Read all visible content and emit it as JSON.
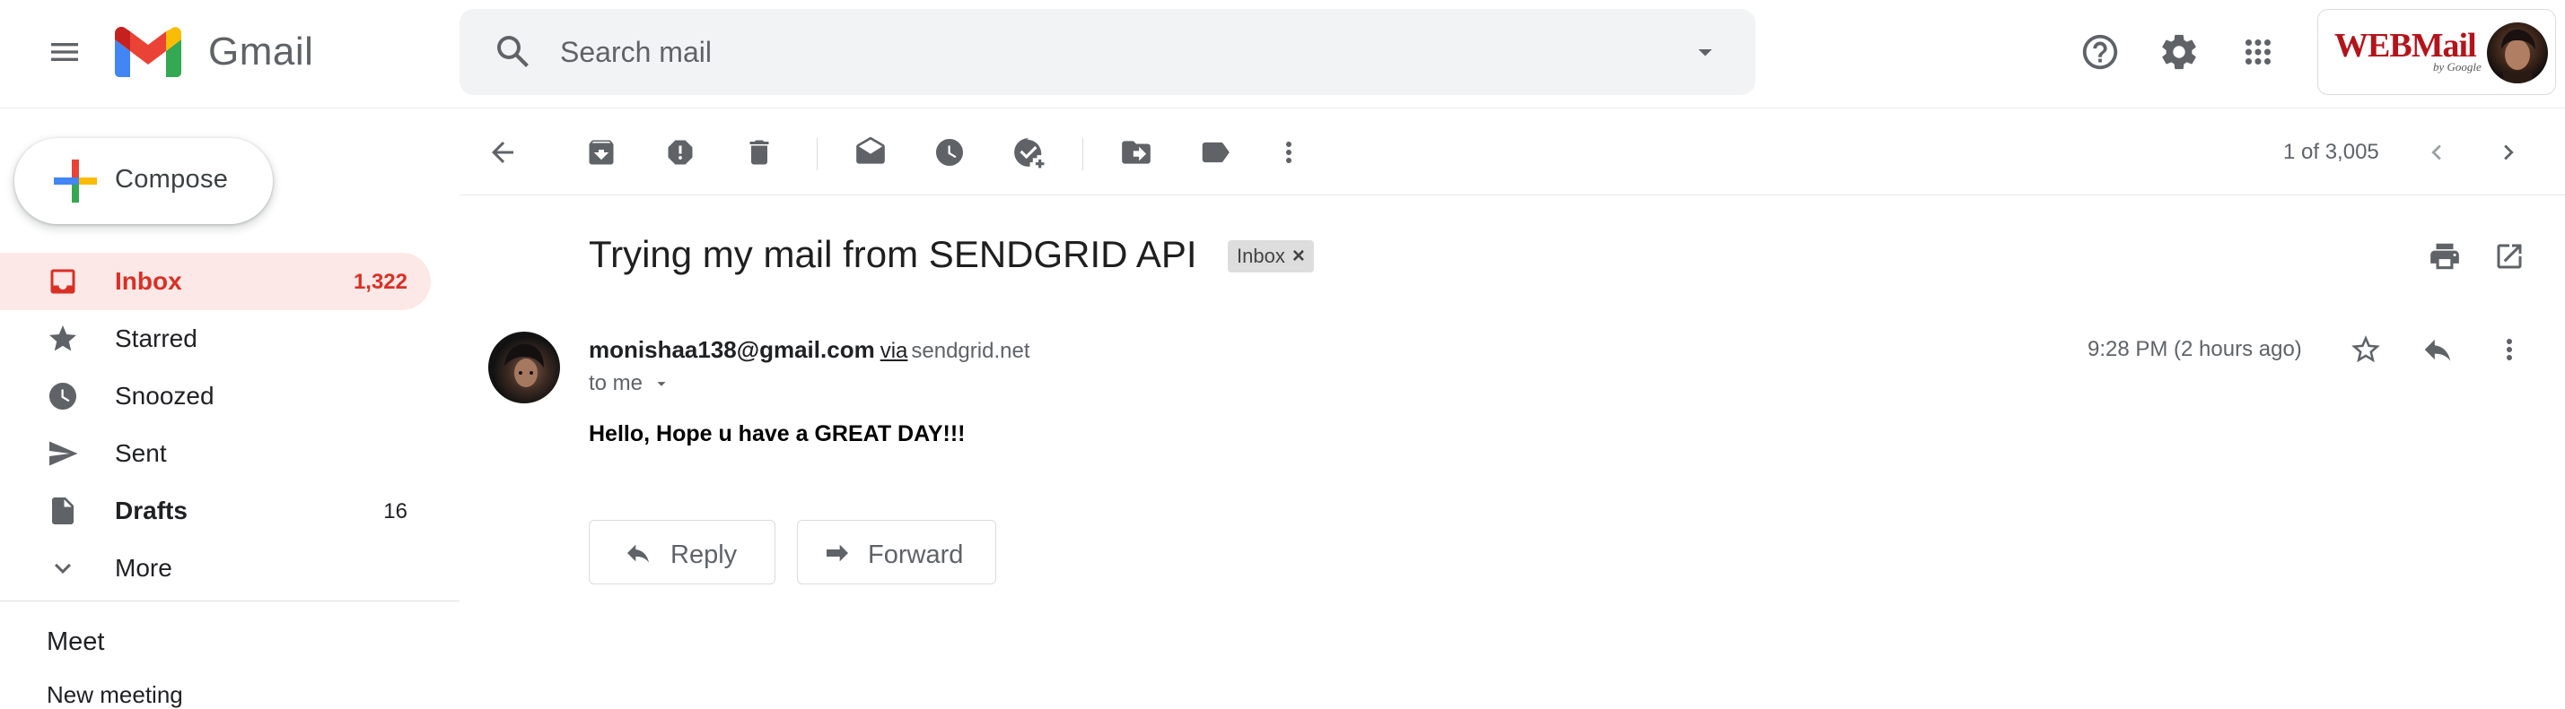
{
  "app": {
    "name": "Gmail"
  },
  "search": {
    "placeholder": "Search mail"
  },
  "account": {
    "logo_text": "WEBMail",
    "logo_sub": "by Google"
  },
  "compose": {
    "label": "Compose"
  },
  "sidebar": {
    "items": [
      {
        "label": "Inbox",
        "count": "1,322",
        "icon": "inbox-icon"
      },
      {
        "label": "Starred",
        "count": "",
        "icon": "star-icon"
      },
      {
        "label": "Snoozed",
        "count": "",
        "icon": "clock-icon"
      },
      {
        "label": "Sent",
        "count": "",
        "icon": "send-icon"
      },
      {
        "label": "Drafts",
        "count": "16",
        "icon": "draft-icon"
      },
      {
        "label": "More",
        "count": "",
        "icon": "chevron-down-icon"
      }
    ],
    "meet_label": "Meet",
    "meet_next": "New meeting"
  },
  "toolbar": {
    "pager": "1 of 3,005"
  },
  "message": {
    "subject": "Trying my mail from SENDGRID API",
    "label_chip": "Inbox",
    "label_chip_close": "×",
    "sender_email": "monishaa138@gmail.com",
    "via": "via",
    "via_domain": "sendgrid.net",
    "to": "to me",
    "time": "9:28 PM (2 hours ago)",
    "body": "Hello, Hope u have a GREAT DAY!!!",
    "reply_label": "Reply",
    "forward_label": "Forward"
  },
  "colors": {
    "accent_red": "#d93025",
    "active_bg": "#fce8e6",
    "icon_gray": "#5f6368",
    "search_bg": "#f1f3f4"
  }
}
